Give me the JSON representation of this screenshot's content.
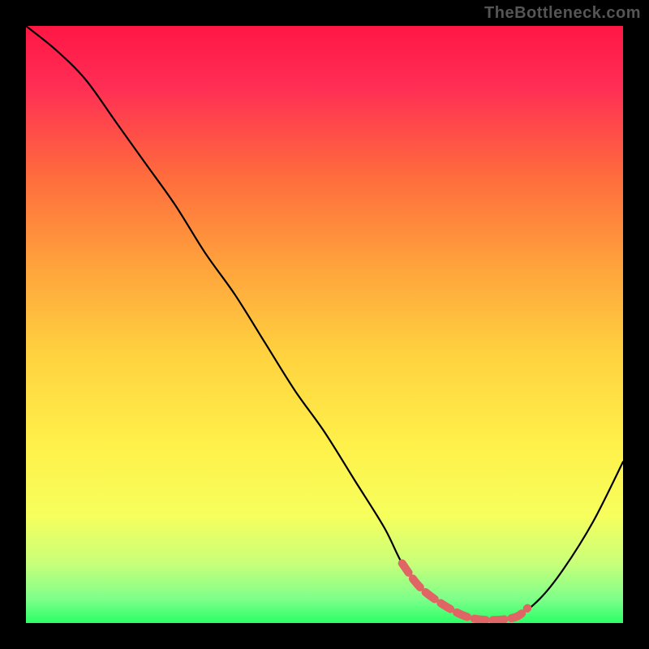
{
  "watermark": "TheBottleneck.com",
  "chart_data": {
    "type": "line",
    "title": "",
    "xlabel": "",
    "ylabel": "",
    "xlim": [
      0,
      100
    ],
    "ylim": [
      0,
      100
    ],
    "series": [
      {
        "name": "bottleneck-curve",
        "x": [
          0,
          5,
          10,
          15,
          20,
          25,
          30,
          35,
          40,
          45,
          50,
          55,
          60,
          63,
          66,
          70,
          74,
          78,
          82,
          86,
          90,
          95,
          100
        ],
        "y": [
          100,
          96,
          91,
          84,
          77,
          70,
          62,
          55,
          47,
          39,
          32,
          24,
          16,
          10,
          6,
          3,
          1,
          0.5,
          1,
          4,
          9,
          17,
          27
        ]
      }
    ],
    "highlight": {
      "name": "optimal-range",
      "x": [
        63,
        66,
        70,
        74,
        78,
        82,
        84
      ],
      "y": [
        10,
        6,
        3,
        1,
        0.5,
        1,
        2.5
      ]
    },
    "gradient_stops": [
      {
        "offset": 0.0,
        "color": "#ff1744"
      },
      {
        "offset": 0.1,
        "color": "#ff2d55"
      },
      {
        "offset": 0.25,
        "color": "#ff6b3d"
      },
      {
        "offset": 0.4,
        "color": "#ffa23c"
      },
      {
        "offset": 0.55,
        "color": "#ffd23f"
      },
      {
        "offset": 0.7,
        "color": "#fff04a"
      },
      {
        "offset": 0.82,
        "color": "#f7ff5c"
      },
      {
        "offset": 0.9,
        "color": "#c8ff7a"
      },
      {
        "offset": 0.96,
        "color": "#7dff8a"
      },
      {
        "offset": 1.0,
        "color": "#2bff66"
      }
    ]
  }
}
